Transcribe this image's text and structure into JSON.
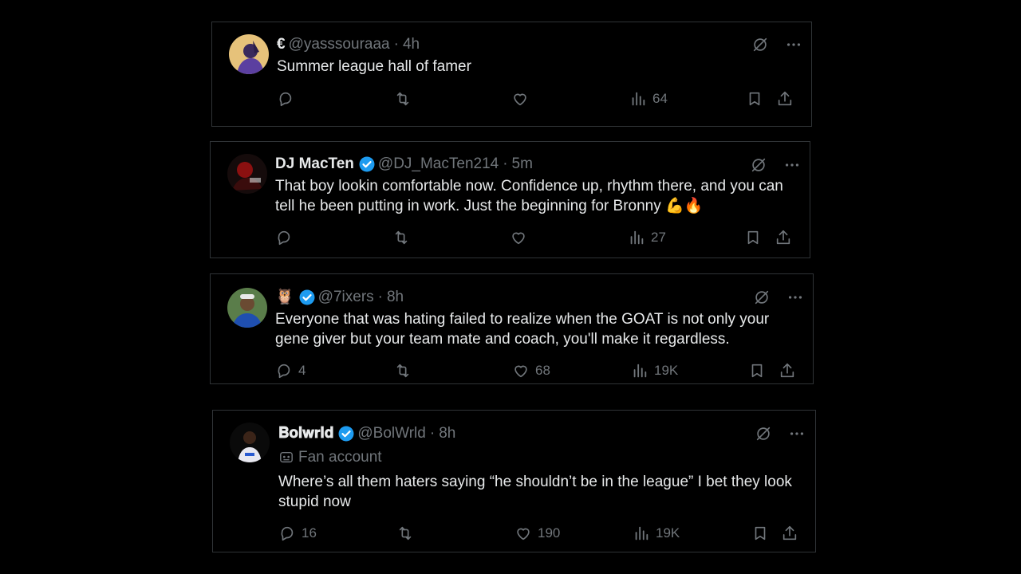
{
  "tweets": [
    {
      "name": "€",
      "handle": "@yasssouraaa",
      "time": "4h",
      "text": "Summer league hall of famer",
      "replies": "",
      "reposts": "",
      "likes": "",
      "views": "64"
    },
    {
      "name": "DJ MacTen",
      "handle": "@DJ_MacTen214",
      "time": "5m",
      "text": "That boy lookin comfortable now. Confidence up, rhythm there, and you can tell he been putting in work. Just the beginning for Bronny 💪🔥",
      "replies": "",
      "reposts": "",
      "likes": "",
      "views": "27"
    },
    {
      "name": "🦉",
      "handle": "@7ixers",
      "time": "8h",
      "text": "Everyone that was hating failed to realize when the GOAT is not only your gene giver but your team mate and coach, you'll make it regardless.",
      "replies": "4",
      "reposts": "",
      "likes": "68",
      "views": "19K"
    },
    {
      "name": "𝐁𝐨𝐥𝐰𝐫𝐥𝐝",
      "handle": "@BolWrld",
      "time": "8h",
      "label": "Fan account",
      "text": "Where’s all them haters saying “he shouldn’t be in the league” I bet they look stupid now",
      "replies": "16",
      "reposts": "",
      "likes": "190",
      "views": "19K"
    }
  ],
  "dot": "·",
  "colors": {
    "background": "#000000",
    "text": "#e7e9ea",
    "muted": "#71767b",
    "verified": "#1d9bf0",
    "border": "#2f3336"
  },
  "icons": [
    "grok-icon",
    "more-icon",
    "reply-icon",
    "repost-icon",
    "like-icon",
    "views-icon",
    "bookmark-icon",
    "share-icon",
    "verified-badge-icon",
    "fan-account-icon"
  ]
}
